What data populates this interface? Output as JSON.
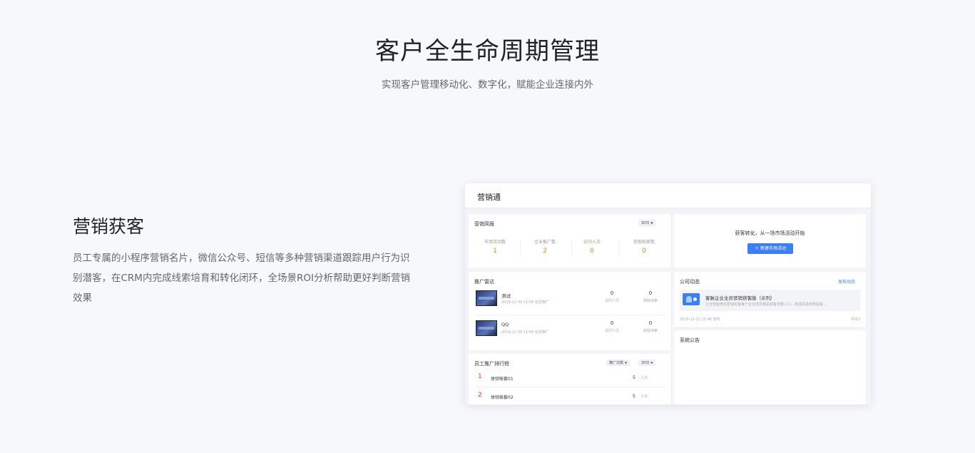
{
  "hero": {
    "title": "客户全生命周期管理",
    "subtitle": "实现客户管理移动化、数字化，赋能企业连接内外"
  },
  "feature": {
    "title": "营销获客",
    "desc": "员工专属的小程序营销名片，微信公众号、短信等多种营销渠道跟踪用户行为识别潜客，在CRM内完成线索培育和转化闭环，全场景ROI分析帮助更好判断营销效果"
  },
  "app": {
    "title": "营销通",
    "brief": {
      "title": "营销简报",
      "period": "30日",
      "stats": [
        {
          "label": "市场活动数",
          "value": "1"
        },
        {
          "label": "企业推广数",
          "value": "2"
        },
        {
          "label": "访问人次",
          "value": "0"
        },
        {
          "label": "获取线索数",
          "value": "0"
        }
      ]
    },
    "empty": {
      "text": "获客转化，从一场市场活动开始",
      "button": "新建市场活动"
    },
    "radar": {
      "title": "推广雷达",
      "items": [
        {
          "name": "测试",
          "meta": "2019-12-30 11:58 全员推广",
          "visits": "0",
          "visits_label": "访问人次",
          "leads": "0",
          "leads_label": "获取线索"
        },
        {
          "name": "QQ",
          "meta": "2019-12-30 11:58 全员推广",
          "visits": "0",
          "visits_label": "访问人次",
          "leads": "0",
          "leads_label": "获取线索"
        }
      ]
    },
    "ranking": {
      "title": "员工推广排行榜",
      "filter": "推广次数",
      "period": "30日",
      "rows": [
        {
          "rank": "1",
          "name": "体验帐套01",
          "value": "5",
          "unit": "人次"
        },
        {
          "rank": "2",
          "name": "体验帐套02",
          "value": "5",
          "unit": "人次"
        }
      ]
    },
    "news": {
      "title": "公司动态",
      "link": "发布动态",
      "item_title": "客脉企业全员营销获客版（示列）",
      "item_sub": "让全智能微信营销有客每个企业成员都是获客流量入口，低成本高效率获客...",
      "date": "2019-11-12 15:46 发布",
      "comments": "评论0"
    },
    "notice": {
      "title": "系统公告"
    }
  },
  "colors": {
    "accent": "#3d7ff2",
    "stat_orange": "#f58220",
    "rank_red": "#e8342c"
  }
}
